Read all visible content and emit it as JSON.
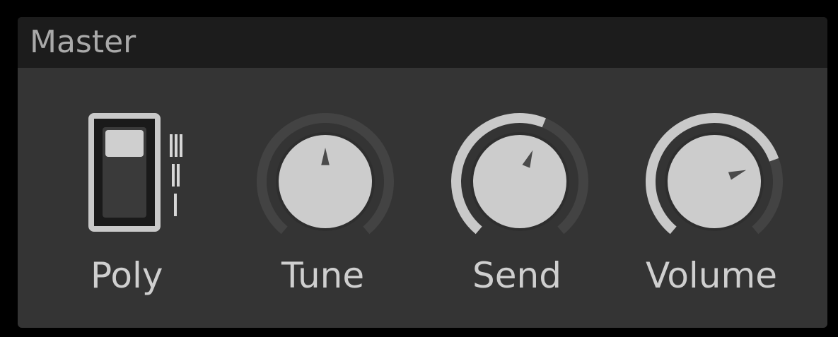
{
  "panel": {
    "title": "Master"
  },
  "colors": {
    "panel_bg": "#343434",
    "header_bg": "#1c1c1c",
    "track": "#434343",
    "arc_fill": "#c9c9c9",
    "knob": "#cccccc",
    "pointer": "#4a4a4a",
    "label": "#cfcfcf"
  },
  "controls": {
    "poly": {
      "label": "Poly",
      "type": "switch",
      "positions": [
        "III",
        "II",
        "I"
      ],
      "selected": "III"
    },
    "tune": {
      "label": "Tune",
      "type": "knob",
      "value": 0.5
    },
    "send": {
      "label": "Send",
      "type": "knob",
      "value": 0.58
    },
    "volume": {
      "label": "Volume",
      "type": "knob",
      "value": 0.75
    }
  }
}
